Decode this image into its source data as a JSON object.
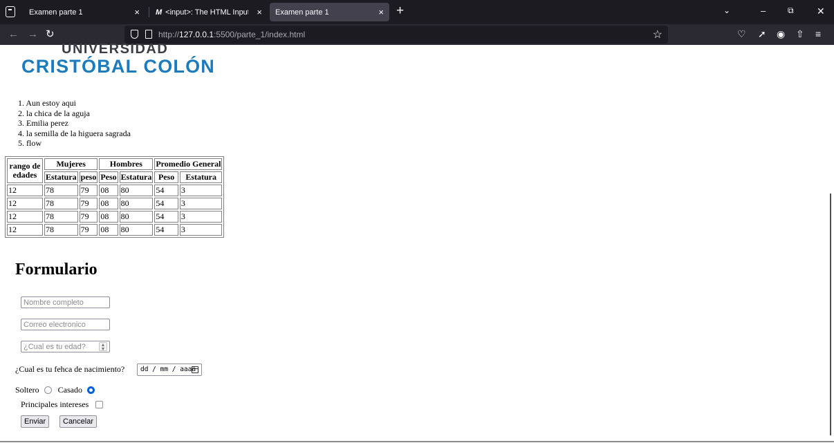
{
  "browser": {
    "tabs": [
      {
        "title": "Examen parte 1",
        "favicon": "",
        "active": false
      },
      {
        "title": "<input>: The HTML Input elem",
        "favicon": "M",
        "active": false
      },
      {
        "title": "Examen parte 1",
        "favicon": "",
        "active": true
      }
    ],
    "new_tab": "+",
    "close_glyph": "×",
    "url_prefix": "http://",
    "url_host": "127.0.0.1",
    "url_path": ":5500/parte_1/index.html"
  },
  "logo": {
    "line1": "UNIVERSIDAD",
    "line2": "CRISTÓBAL COLÓN"
  },
  "movies": [
    "1. Aun estoy aqui",
    "2. la chica de la aguja",
    "3. Emilia perez",
    "4. la semilla de la higuera sagrada",
    "5. flow"
  ],
  "table": {
    "header_age": "rango de edades",
    "groups": [
      "Mujeres",
      "Hombres",
      "Promedio General"
    ],
    "subheaders": [
      "Estatura",
      "peso",
      "Peso",
      "Estatura",
      "Peso",
      "Estatura"
    ],
    "rows": [
      [
        "12",
        "78",
        "79",
        "08",
        "80",
        "54",
        "3"
      ],
      [
        "12",
        "78",
        "79",
        "08",
        "80",
        "54",
        "3"
      ],
      [
        "12",
        "78",
        "79",
        "08",
        "80",
        "54",
        "3"
      ],
      [
        "12",
        "78",
        "79",
        "08",
        "80",
        "54",
        "3"
      ]
    ]
  },
  "form": {
    "title": "Formulario",
    "name_placeholder": "Nombre completo",
    "email_placeholder": "Correo electronico",
    "age_placeholder": "¿Cual es tu edad?",
    "dob_label": "¿Cual es tu fehca de nacimiento?",
    "dob_placeholder": "dd / mm / aaaa",
    "single_label": "Soltero",
    "married_label": "Casado",
    "single_checked": false,
    "married_checked": true,
    "interests_label": "Principales intereses",
    "interests_checked": false,
    "submit_label": "Enviar",
    "cancel_label": "Cancelar"
  },
  "colors": {
    "tabbar": "#1c1b22",
    "navbar": "#2b2a33",
    "active_tab": "#42414d",
    "logo_blue": "#1b7bbe",
    "logo_gray": "#3a3e44",
    "radio_checked": "#0060df"
  },
  "icons": [
    "tab-overview-icon",
    "close-icon",
    "new-tab-icon",
    "chevron-down-icon",
    "minimize-icon",
    "restore-icon",
    "window-close-icon",
    "back-icon",
    "forward-icon",
    "reload-icon",
    "shield-icon",
    "page-icon",
    "bookmark-star-icon",
    "pocket-icon",
    "devtools-wrench-icon",
    "account-icon",
    "share-icon",
    "menu-icon",
    "calendar-icon",
    "spinner-icon"
  ]
}
